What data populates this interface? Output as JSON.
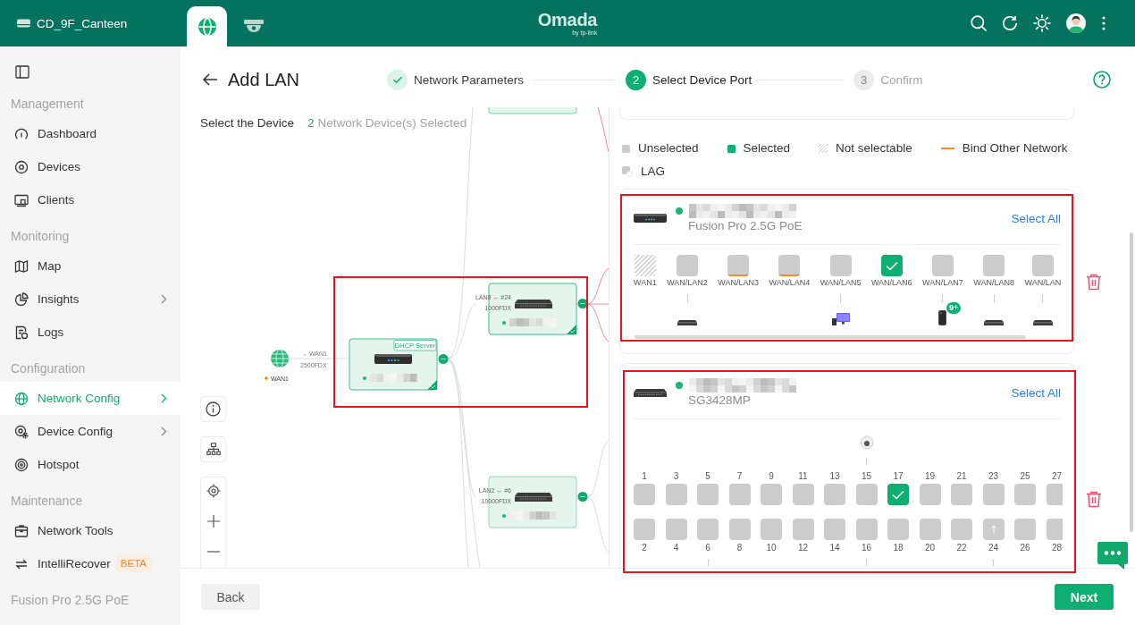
{
  "topbar": {
    "site": "CD_9F_Canteen",
    "tabs": [
      {
        "selected": true
      },
      {
        "selected": false
      }
    ],
    "logo": "Omada",
    "logo_tagline": "by tp-link"
  },
  "sidebar": {
    "sections": [
      {
        "title": "Management",
        "items": [
          {
            "label": "Dashboard",
            "selected": false,
            "submenu": false
          },
          {
            "label": "Devices",
            "selected": false,
            "submenu": false
          },
          {
            "label": "Clients",
            "selected": false,
            "submenu": false
          }
        ]
      },
      {
        "title": "Monitoring",
        "items": [
          {
            "label": "Map",
            "selected": false,
            "submenu": false
          },
          {
            "label": "Insights",
            "selected": false,
            "submenu": true
          },
          {
            "label": "Logs",
            "selected": false,
            "submenu": false
          }
        ]
      },
      {
        "title": "Configuration",
        "items": [
          {
            "label": "Network Config",
            "selected": true,
            "submenu": true
          },
          {
            "label": "Device Config",
            "selected": false,
            "submenu": true
          },
          {
            "label": "Hotspot",
            "selected": false,
            "submenu": false
          }
        ]
      },
      {
        "title": "Maintenance",
        "items": [
          {
            "label": "Network Tools",
            "selected": false,
            "submenu": false
          },
          {
            "label": "IntelliRecover",
            "selected": false,
            "submenu": false,
            "badge": "BETA"
          }
        ]
      },
      {
        "title": "Fusion Pro 2.5G PoE"
      }
    ]
  },
  "page": {
    "title": "Add LAN",
    "steps": [
      {
        "label": "Network Parameters",
        "completed": true,
        "selected": false
      },
      {
        "number": "2",
        "label": "Select Device Port",
        "completed": false,
        "selected": true
      },
      {
        "number": "3",
        "label": "Confirm",
        "completed": false,
        "selected": false
      }
    ]
  },
  "device_select": {
    "title": "Select the Device",
    "count": "2",
    "count_label": "Network Device(s) Selected",
    "topology": {
      "wan_port": "WAN1",
      "uplink_label": "→ WAN1",
      "uplink_speed": "2500FDX",
      "nodes": [
        {
          "tag": "DHCP Server",
          "selected": true
        },
        {
          "link_label": "LAN8 ↔ #24",
          "link_speed": "1000FDX",
          "selected": true
        },
        {
          "link_label": "LAN2 ↔ #6",
          "link_speed": "10000FDX",
          "selected": false
        }
      ]
    }
  },
  "port_select": {
    "legend": [
      {
        "kind": "unselected",
        "label": "Unselected"
      },
      {
        "kind": "selected",
        "label": "Selected"
      },
      {
        "kind": "unavailable",
        "label": "Not selectable"
      },
      {
        "kind": "bound",
        "label": "Bind Other Network"
      },
      {
        "kind": "lag",
        "label": "LAG"
      }
    ],
    "devices": [
      {
        "kind": "single",
        "model": "Fusion Pro 2.5G PoE",
        "online": true,
        "select_all": "Select All",
        "ports": [
          {
            "label": "WAN1",
            "selected": false,
            "disabled": true,
            "bound": false,
            "linked": false
          },
          {
            "label": "WAN/LAN2",
            "selected": false,
            "disabled": false,
            "bound": false,
            "linked": true,
            "client": {
              "kind": "switch"
            }
          },
          {
            "label": "WAN/LAN3",
            "selected": false,
            "disabled": false,
            "bound": true,
            "linked": false
          },
          {
            "label": "WAN/LAN4",
            "selected": false,
            "disabled": false,
            "bound": true,
            "linked": false
          },
          {
            "label": "WAN/LAN5",
            "selected": false,
            "disabled": false,
            "bound": false,
            "linked": true,
            "client": {
              "kind": "computer"
            }
          },
          {
            "label": "WAN/LAN6",
            "selected": true,
            "disabled": false,
            "bound": false,
            "linked": false
          },
          {
            "label": "WAN/LAN7",
            "selected": false,
            "disabled": false,
            "bound": false,
            "linked": true,
            "client": {
              "kind": "phone",
              "count": "9+"
            }
          },
          {
            "label": "WAN/LAN8",
            "selected": false,
            "disabled": false,
            "bound": false,
            "linked": true,
            "client": {
              "kind": "switch"
            }
          },
          {
            "label": "WAN/LAN",
            "selected": false,
            "disabled": false,
            "bound": false,
            "linked": true,
            "client": {
              "kind": "switch"
            }
          }
        ]
      },
      {
        "kind": "double",
        "model": "SG3428MP",
        "online": true,
        "select_all": "Select All",
        "ports": [
          {
            "label": "1",
            "selected": false,
            "linked": false,
            "uplink": false
          },
          {
            "label": "2",
            "selected": false,
            "linked": false,
            "uplink": false
          },
          {
            "label": "3",
            "selected": false,
            "linked": false,
            "uplink": false
          },
          {
            "label": "4",
            "selected": false,
            "linked": false,
            "uplink": false
          },
          {
            "label": "5",
            "selected": false,
            "linked": false,
            "uplink": false
          },
          {
            "label": "6",
            "selected": false,
            "linked": true,
            "uplink": false
          },
          {
            "label": "7",
            "selected": false,
            "linked": false,
            "uplink": false
          },
          {
            "label": "8",
            "selected": false,
            "linked": false,
            "uplink": false
          },
          {
            "label": "9",
            "selected": false,
            "linked": false,
            "uplink": false
          },
          {
            "label": "10",
            "selected": false,
            "linked": false,
            "uplink": false
          },
          {
            "label": "11",
            "selected": false,
            "linked": false,
            "uplink": false
          },
          {
            "label": "12",
            "selected": false,
            "linked": false,
            "uplink": false
          },
          {
            "label": "13",
            "selected": false,
            "linked": false,
            "uplink": false
          },
          {
            "label": "14",
            "selected": false,
            "linked": false,
            "uplink": false
          },
          {
            "label": "15",
            "selected": false,
            "linked": true,
            "uplink": false,
            "client": {
              "kind": "camera"
            }
          },
          {
            "label": "16",
            "selected": false,
            "linked": true,
            "uplink": false
          },
          {
            "label": "17",
            "selected": true,
            "linked": false,
            "uplink": false
          },
          {
            "label": "18",
            "selected": false,
            "linked": false,
            "uplink": false
          },
          {
            "label": "19",
            "selected": false,
            "linked": false,
            "uplink": false
          },
          {
            "label": "20",
            "selected": false,
            "linked": false,
            "uplink": false
          },
          {
            "label": "21",
            "selected": false,
            "linked": false,
            "uplink": false
          },
          {
            "label": "22",
            "selected": false,
            "linked": false,
            "uplink": false
          },
          {
            "label": "23",
            "selected": false,
            "linked": false,
            "uplink": false
          },
          {
            "label": "24",
            "selected": false,
            "linked": true,
            "uplink": true
          },
          {
            "label": "25",
            "selected": false,
            "linked": false,
            "uplink": false
          },
          {
            "label": "26",
            "selected": false,
            "linked": false,
            "uplink": false
          },
          {
            "label": "27",
            "selected": false,
            "linked": false,
            "uplink": false
          },
          {
            "label": "28",
            "selected": false,
            "linked": false,
            "uplink": false
          }
        ]
      }
    ]
  },
  "footer": {
    "back": "Back",
    "next": "Next"
  }
}
